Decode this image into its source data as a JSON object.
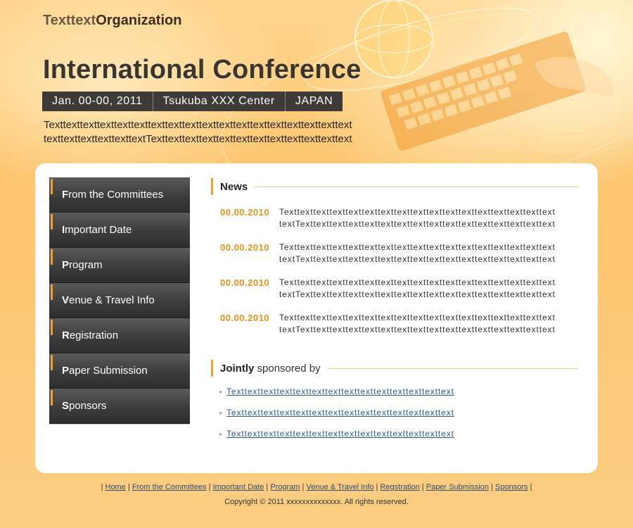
{
  "header": {
    "org_part1": "Texttext",
    "org_part2": "Organization",
    "title": "International Conference",
    "info": [
      "Jan. 00-00, 2011",
      "Tsukuba XXX Center",
      "JAPAN"
    ],
    "intro_line1": "Texttexttexttexttexttexttexttexttexttexttexttexttexttexttexttexttexttext",
    "intro_line2": "texttexttexttexttexttextTexttexttexttexttexttexttexttexttexttexttexttext"
  },
  "menu": [
    {
      "initial": "F",
      "rest": "rom the Committees"
    },
    {
      "initial": "I",
      "rest": "mportant Date"
    },
    {
      "initial": "P",
      "rest": "rogram"
    },
    {
      "initial": "V",
      "rest": "enue & Travel Info"
    },
    {
      "initial": "R",
      "rest": "egistration"
    },
    {
      "initial": "P",
      "rest": "aper Submission"
    },
    {
      "initial": "S",
      "rest": "ponsors"
    }
  ],
  "news": {
    "heading": "News",
    "items": [
      {
        "date": "00.00.2010",
        "line1": "Texttexttexttexttexttexttexttexttexttexttexttexttexttexttexttexttext",
        "line2": "textTexttexttexttexttexttexttexttexttexttexttexttexttexttexttexttext"
      },
      {
        "date": "00.00.2010",
        "line1": "Texttexttexttexttexttexttexttexttexttexttexttexttexttexttexttexttext",
        "line2": "textTexttexttexttexttexttexttexttexttexttexttexttexttexttexttexttext"
      },
      {
        "date": "00.00.2010",
        "line1": "Texttexttexttexttexttexttexttexttexttexttexttexttexttexttexttexttext",
        "line2": "textTexttexttexttexttexttexttexttexttexttexttexttexttexttexttexttext"
      },
      {
        "date": "00.00.2010",
        "line1": "Texttexttexttexttexttexttexttexttexttexttexttexttexttexttexttexttext",
        "line2": "textTexttexttexttexttexttexttexttexttexttexttexttexttexttexttexttext"
      }
    ]
  },
  "sponsors": {
    "heading_bold": "Jointly",
    "heading_rest": " sponsored by",
    "links": [
      "Texttexttexttexttexttexttexttexttexttexttexttexttexttext",
      "Texttexttexttexttexttexttexttexttexttexttexttexttexttext",
      "Texttexttexttexttexttexttexttexttexttexttexttexttexttext"
    ]
  },
  "footer": {
    "links": [
      "Home",
      "From the Committees",
      "Important Date",
      "Program",
      "Venue & Travel Info",
      "Regstration",
      "Paper Submission",
      "Sponsors"
    ],
    "copyright": "Copyright © 2011 xxxxxxxxxxxxxx. All rights reserved."
  },
  "colors": {
    "accent": "#f0a030",
    "date": "#e8921c",
    "link": "#2c5d8f",
    "menu_dark": "#3c3c3c"
  }
}
